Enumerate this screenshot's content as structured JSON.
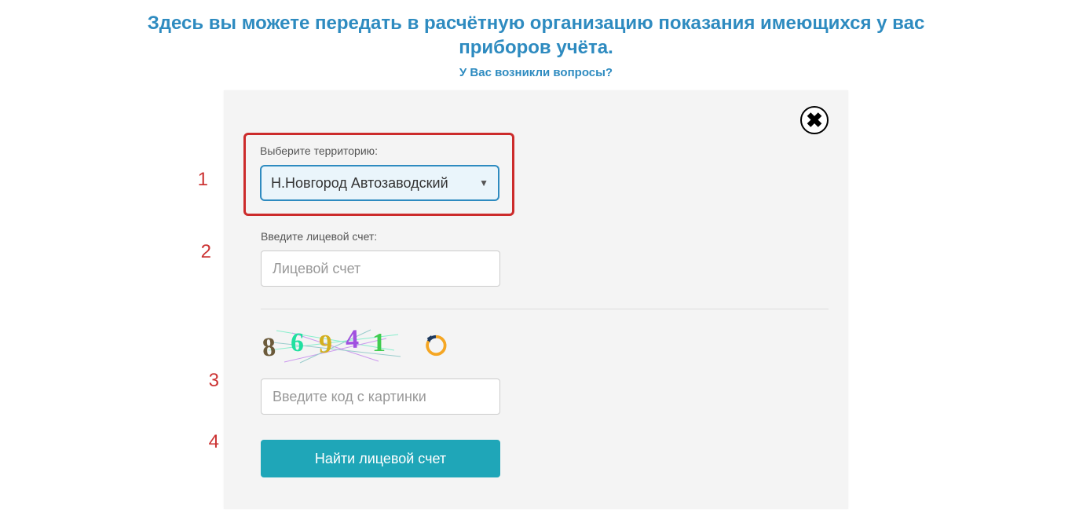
{
  "header": {
    "title": "Здесь вы можете передать в расчётную организацию показания имеющихся у вас приборов учёта.",
    "help_link": "У Вас возникли вопросы?"
  },
  "steps": {
    "s1": "1",
    "s2": "2",
    "s3": "3",
    "s4": "4"
  },
  "form": {
    "territory_label": "Выберите территорию:",
    "territory_value": "Н.Новгород Автозаводский",
    "account_label": "Введите лицевой счет:",
    "account_placeholder": "Лицевой счет",
    "captcha_digits": [
      "8",
      "6",
      "9",
      "4",
      "1"
    ],
    "captcha_placeholder": "Введите код с картинки",
    "submit_label": "Найти лицевой счет"
  }
}
